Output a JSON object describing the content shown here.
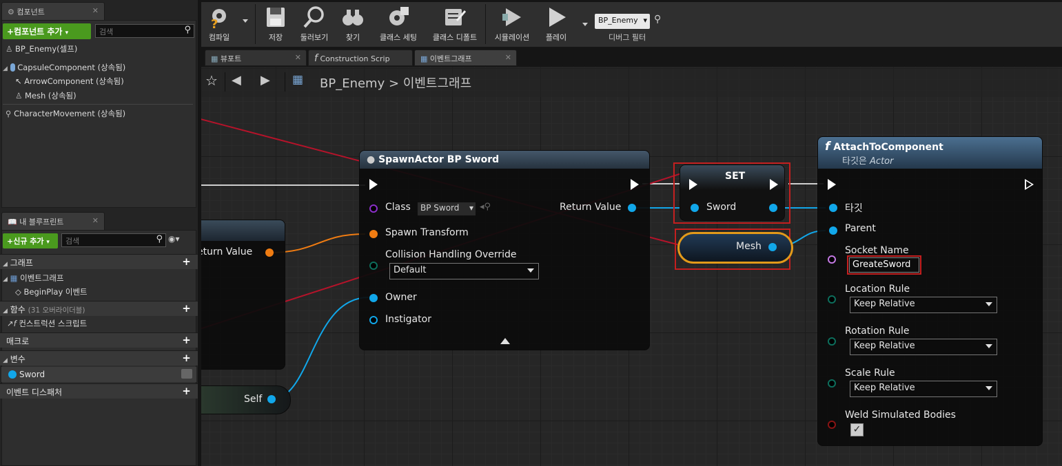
{
  "components_panel": {
    "tab_label": "컴포넌트",
    "add_button": "+컴포넌트 추가",
    "search_placeholder": "검색",
    "items": [
      "BP_Enemy(셀프)",
      "CapsuleComponent (상속됨)",
      "ArrowComponent (상속됨)",
      "Mesh (상속됨)",
      "CharacterMovement (상속됨)"
    ]
  },
  "my_blueprint_panel": {
    "tab_label": "내 블루프린트",
    "add_button": "+신규 추가",
    "search_placeholder": "검색",
    "sections": {
      "graph": "그래프",
      "event_graph": "이벤트그래프",
      "begin_play": "BeginPlay 이벤트",
      "functions": "함수",
      "functions_count": "(31 오버라이더블)",
      "construction_script": "컨스트럭션 스크립트",
      "macros": "매크로",
      "variables": "변수",
      "sword_var": "Sword",
      "event_dispatchers": "이벤트 디스패처"
    }
  },
  "toolbar": {
    "compile": "컴파일",
    "save": "저장",
    "browse": "둘러보기",
    "find": "찾기",
    "class_settings": "클래스 세팅",
    "class_defaults": "클래스 디폴트",
    "simulation": "시뮬레이션",
    "play": "플레이",
    "debug_object": "BP_Enemy",
    "debug_filter": "디버그 필터"
  },
  "doc_tabs": [
    "뷰포트",
    "Construction Scrip",
    "이벤트그래프"
  ],
  "breadcrumb": {
    "blueprint": "BP_Enemy",
    "separator": ">",
    "graph": "이벤트그래프"
  },
  "nodes": {
    "spawn_actor": {
      "title": "SpawnActor BP Sword",
      "class_label": "Class",
      "class_value": "BP Sword",
      "spawn_transform": "Spawn Transform",
      "collision_override": "Collision Handling Override",
      "collision_value": "Default",
      "owner": "Owner",
      "instigator": "Instigator",
      "return_value": "Return Value"
    },
    "partial_return": "eturn Value",
    "self_node": "Self",
    "set_node": {
      "title": "SET",
      "var": "Sword"
    },
    "mesh_getter": "Mesh",
    "attach": {
      "title": "AttachToComponent",
      "subtitle_prefix": "타깃은",
      "subtitle_target": "Actor",
      "target": "타깃",
      "parent": "Parent",
      "socket_name": "Socket Name",
      "socket_value": "GreateSword",
      "location_rule": "Location Rule",
      "location_value": "Keep Relative",
      "rotation_rule": "Rotation Rule",
      "rotation_value": "Keep Relative",
      "scale_rule": "Scale Rule",
      "scale_value": "Keep Relative",
      "weld": "Weld Simulated Bodies",
      "weld_checked": true
    }
  },
  "colors": {
    "object_pin": "#11a7ea",
    "struct_pin": "#f07c12",
    "class_pin": "#8b2fc9",
    "name_pin": "#c479e3",
    "byte_pin": "#0d6e5c",
    "bool_pin": "#8a1414",
    "annotation": "#b5132a",
    "compile_green": "#4a9a1e"
  }
}
